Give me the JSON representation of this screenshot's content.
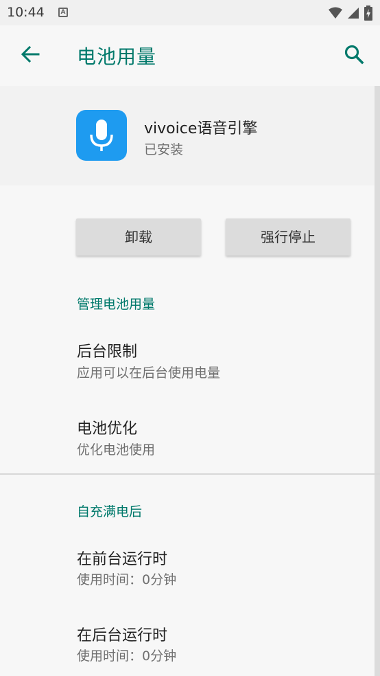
{
  "status_bar": {
    "time": "10:44",
    "notification_letter": "A"
  },
  "app_bar": {
    "title": "电池用量"
  },
  "app_info": {
    "name": "vivoice语音引擎",
    "status": "已安装"
  },
  "buttons": {
    "uninstall": "卸载",
    "force_stop": "强行停止"
  },
  "manage_section": {
    "title": "管理电池用量",
    "items": [
      {
        "title": "后台限制",
        "subtitle": "应用可以在后台使用电量"
      },
      {
        "title": "电池优化",
        "subtitle": "优化电池使用"
      }
    ]
  },
  "since_full_charge": {
    "title": "自充满电后",
    "items": [
      {
        "title": "在前台运行时",
        "subtitle": "使用时间：0分钟"
      },
      {
        "title": "在后台运行时",
        "subtitle": "使用时间：0分钟"
      }
    ]
  },
  "colors": {
    "accent": "#00796b",
    "app_icon_bg": "#1e9bf0",
    "button_bg": "#dcdcdc"
  }
}
